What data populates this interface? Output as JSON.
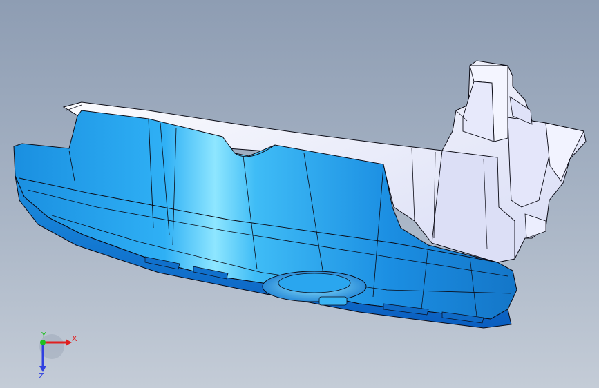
{
  "viewport": {
    "background_top": "#8e9db3",
    "background_bottom": "#c4ccd7"
  },
  "model": {
    "body_color": "#1e9ae6",
    "highlight_color": "#8ee6ff",
    "shell_color": "#eef0ff",
    "edge_color": "#0a0a14"
  },
  "triad": {
    "x_label": "X",
    "y_label": "Y",
    "z_label": "Z",
    "x_color": "#e02020",
    "y_color": "#20c020",
    "z_color": "#3040e0"
  }
}
